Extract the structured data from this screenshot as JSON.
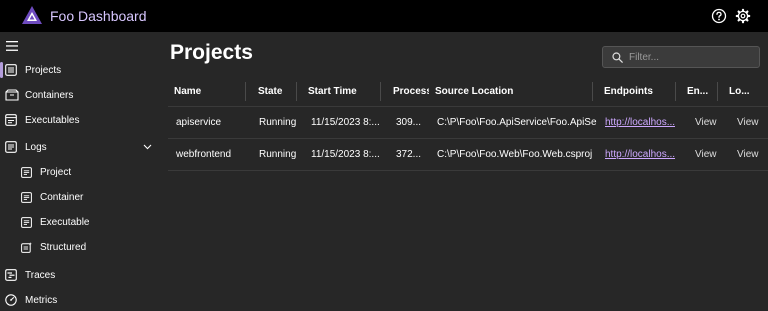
{
  "app": {
    "title": "Foo Dashboard"
  },
  "colors": {
    "accent": "#b39ddb",
    "link": "#cda8ff",
    "background": "#272727",
    "topbar": "#000000"
  },
  "nav": {
    "items": [
      {
        "label": "Projects",
        "icon": "projects-icon",
        "active": true
      },
      {
        "label": "Containers",
        "icon": "containers-icon"
      },
      {
        "label": "Executables",
        "icon": "executables-icon"
      },
      {
        "label": "Logs",
        "icon": "logs-icon",
        "expanded": true
      },
      {
        "label": "Project",
        "icon": "project-log-icon"
      },
      {
        "label": "Container",
        "icon": "container-log-icon"
      },
      {
        "label": "Executable",
        "icon": "executable-log-icon"
      },
      {
        "label": "Structured",
        "icon": "structured-log-icon"
      },
      {
        "label": "Traces",
        "icon": "traces-icon"
      },
      {
        "label": "Metrics",
        "icon": "metrics-icon"
      }
    ]
  },
  "page": {
    "title": "Projects"
  },
  "filter": {
    "placeholder": "Filter..."
  },
  "table": {
    "columns": [
      "Name",
      "State",
      "Start Time",
      "Process",
      "Source Location",
      "Endpoints",
      "En...",
      "Lo..."
    ],
    "rows": [
      {
        "name": "apiservice",
        "state": "Running",
        "start_time": "11/15/2023 8:...",
        "process": "309...",
        "source": "C:\\P\\Foo\\Foo.ApiService\\Foo.ApiSe...",
        "endpoint": "http://localhos...",
        "env": "View",
        "logs": "View"
      },
      {
        "name": "webfrontend",
        "state": "Running",
        "start_time": "11/15/2023 8:...",
        "process": "372...",
        "source": "C:\\P\\Foo\\Foo.Web\\Foo.Web.csproj",
        "endpoint": "http://localhos...",
        "env": "View",
        "logs": "View"
      }
    ]
  }
}
